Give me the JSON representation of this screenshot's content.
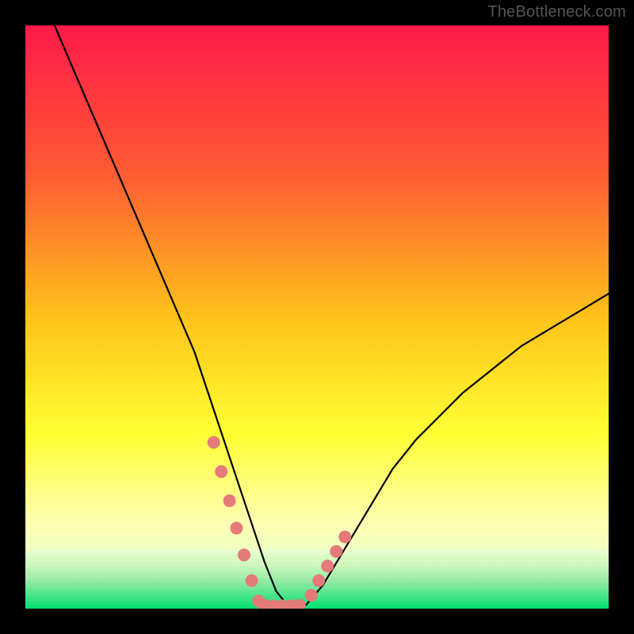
{
  "watermark": "TheBottleneck.com",
  "chart_data": {
    "type": "line",
    "title": "",
    "xlabel": "",
    "ylabel": "",
    "xlim": [
      0,
      100
    ],
    "ylim": [
      0,
      100
    ],
    "background_gradient": {
      "stops": [
        {
          "offset": 0.0,
          "color": "#ff1a4a"
        },
        {
          "offset": 0.25,
          "color": "#ff5a33"
        },
        {
          "offset": 0.5,
          "color": "#ffc21a"
        },
        {
          "offset": 0.7,
          "color": "#ffff33"
        },
        {
          "offset": 0.85,
          "color": "#ffffb0"
        },
        {
          "offset": 0.93,
          "color": "#e6ffcc"
        },
        {
          "offset": 0.97,
          "color": "#80f7a8"
        },
        {
          "offset": 1.0,
          "color": "#00e676"
        }
      ]
    },
    "bottom_band_edges": [
      {
        "offset": 0.0,
        "color": "#e6ffd0"
      },
      {
        "offset": 0.25,
        "color": "#ccf7b8"
      },
      {
        "offset": 0.55,
        "color": "#8ce8a0"
      },
      {
        "offset": 1.0,
        "color": "#00e070"
      }
    ],
    "series": [
      {
        "name": "bottleneck-curve",
        "color": "#000000",
        "stroke_width": 2.2,
        "x": [
          5,
          8,
          11,
          14,
          17,
          20,
          23,
          26,
          29,
          31,
          33,
          35,
          37,
          39,
          41,
          43,
          45,
          48,
          51,
          54,
          57,
          60,
          63,
          67,
          71,
          75,
          80,
          85,
          90,
          95,
          100
        ],
        "y": [
          100,
          93,
          86,
          79,
          72,
          65,
          58,
          51,
          44,
          38,
          32,
          26,
          20,
          14,
          8,
          3,
          0.5,
          0.5,
          4,
          9,
          14,
          19,
          24,
          29,
          33,
          37,
          41,
          45,
          48,
          51,
          54
        ]
      },
      {
        "name": "highlight-dots-left",
        "type": "scatter",
        "color": "#e47a7a",
        "radius": 8,
        "x": [
          32.3,
          33.6,
          35.0,
          36.2,
          37.5,
          38.8,
          40.0
        ],
        "y": [
          28.5,
          23.5,
          18.5,
          13.8,
          9.2,
          4.8,
          1.3
        ]
      },
      {
        "name": "highlight-dots-bottom",
        "type": "scatter",
        "color": "#e47a7a",
        "radius": 8,
        "x": [
          41.0,
          42.5,
          44.0,
          45.5,
          47.0
        ],
        "y": [
          0.6,
          0.5,
          0.5,
          0.5,
          0.6
        ]
      },
      {
        "name": "highlight-dots-right",
        "type": "scatter",
        "color": "#e47a7a",
        "radius": 8,
        "x": [
          49.0,
          50.3,
          51.8,
          53.3,
          54.8
        ],
        "y": [
          2.3,
          4.8,
          7.3,
          9.8,
          12.3
        ]
      }
    ]
  }
}
